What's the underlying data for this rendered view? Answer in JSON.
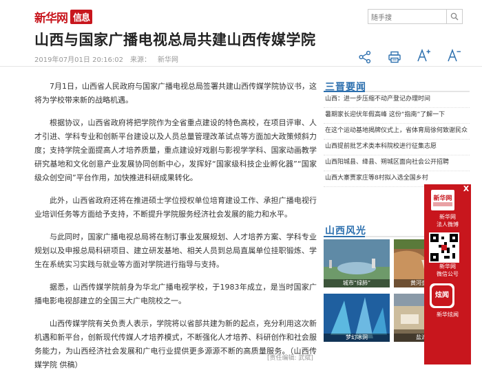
{
  "header": {
    "logo_text": "新华网",
    "logo_sub": "信息",
    "search_placeholder": "随手搜"
  },
  "article": {
    "title": "山西与国家广播电视总局共建山西传媒学院",
    "datetime": "2019年07月01日 20:16:02",
    "source_label": "来源：",
    "source": "新华网",
    "paragraphs": [
      "7月1日，山西省人民政府与国家广播电视总局签署共建山西传媒学院协议书，这将为学校带来新的战略机遇。",
      "根据协议，山西省政府将把学院作为全省重点建设的特色高校，在项目评审、人才引进、学科专业和创新平台建设以及人员总量管理改革试点等方面加大政策倾斜力度；支持学院全面提高人才培养质量，重点建设好戏剧与影视学学科、国家动画教学研究基地和文化创意产业发展协同创新中心，发挥好“国家级科技企业孵化器”“国家级众创空间”平台作用，加快推进科研成果转化。",
      "此外，山西省政府还将在推进硕士学位授权单位培育建设工作、承担广播电视行业培训任务等方面给予支持，不断提升学院服务经济社会发展的能力和水平。",
      "与此同时，国家广播电视总局将在制订事业发展规划、人才培养方案、学科专业规划以及申报总局科研项目、建立研发基地、相关人员到总局直属单位挂职锻炼、学生在系统实习实践与就业等方面对学院进行指导与支持。",
      "据悉，山西传媒学院前身为华北广播电视学校，于1983年成立，是当时国家广播电影电视部建立的全国三大广电院校之一。",
      "山西传媒学院有关负责人表示，学院将以省部共建为新的起点，充分利用这次新机遇和新平台，创新现代传媒人才培养模式，不断强化人才培养、科研创作和社会服务能力，为山西经济社会发展和广电行业提供更多源源不断的高质量服务。（山西传媒学院 供稿）"
    ],
    "editor": "[责任编辑: 武斌]"
  },
  "sidebar": {
    "news_heading": "三晋要闻",
    "news": [
      "山西：进一步压缩不动产登记办理时间",
      "暑期家长迎伏年假高峰 这份“指南”了解一下",
      "在这个运动基地揭牌仪式上，省体育局徐何致谢民众",
      "山西提前批艺术类本科院校进行征集志愿",
      "山西阳城县、绛县、朔城区面向社会公开招聘",
      "山西大寨贾家庄等8村拟入选全国乡村"
    ],
    "gallery_heading": "山西风光",
    "photos": [
      {
        "caption": "城市“绿肺”",
        "colors": [
          "#4a7d9e",
          "#8fb0c4"
        ]
      },
      {
        "caption": "黄河壶口瀑布",
        "colors": [
          "#8a5a3a",
          "#c08858"
        ]
      },
      {
        "caption": "梦幻冰洞",
        "colors": [
          "#1c5c9c",
          "#5cc0e8"
        ]
      },
      {
        "caption": "盐湖采收",
        "colors": [
          "#7a6a50",
          "#d8c8a8"
        ]
      }
    ]
  },
  "float_panel": {
    "close": "X",
    "item1_title": "新华网",
    "item1_label_1": "新华网",
    "item1_label_2": "法人微博",
    "item2_label_1": "新华网",
    "item2_label_2": "微信公号",
    "item3_title": "炫闻",
    "item3_label_1": "新华炫闻"
  },
  "colors": {
    "brand_red": "#c8161d",
    "accent_blue": "#2c6fae"
  }
}
